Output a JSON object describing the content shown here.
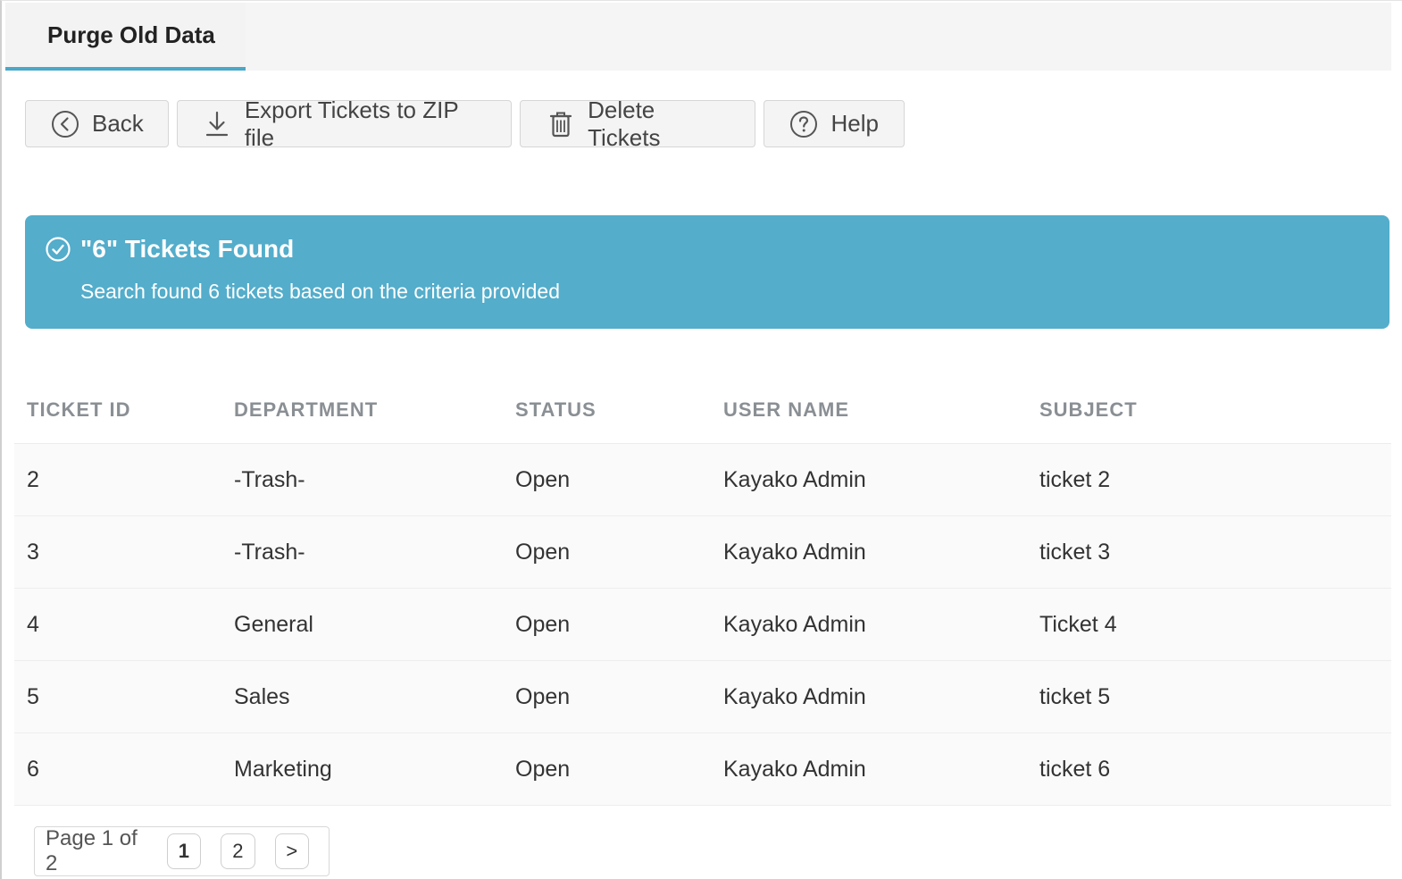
{
  "tabs": [
    {
      "label": "Purge Old Data"
    }
  ],
  "toolbar": {
    "back_label": "Back",
    "export_label": "Export Tickets to ZIP file",
    "delete_label": "Delete Tickets",
    "help_label": "Help"
  },
  "alert": {
    "title": "\"6\" Tickets Found",
    "message": "Search found 6 tickets based on the criteria provided",
    "color": "#53adcb"
  },
  "table": {
    "columns": [
      "TICKET ID",
      "DEPARTMENT",
      "STATUS",
      "USER NAME",
      "SUBJECT"
    ],
    "rows": [
      [
        "2",
        "-Trash-",
        "Open",
        "Kayako Admin",
        "ticket 2"
      ],
      [
        "3",
        "-Trash-",
        "Open",
        "Kayako Admin",
        "ticket 3"
      ],
      [
        "4",
        "General",
        "Open",
        "Kayako Admin",
        "Ticket 4"
      ],
      [
        "5",
        "Sales",
        "Open",
        "Kayako Admin",
        "ticket 5"
      ],
      [
        "6",
        "Marketing",
        "Open",
        "Kayako Admin",
        "ticket 6"
      ]
    ]
  },
  "pagination": {
    "label": "Page 1 of 2",
    "pages": [
      "1",
      "2"
    ],
    "current": "1",
    "next_label": ">"
  },
  "icons": {
    "back": "chevron-left-circle-icon",
    "export": "download-icon",
    "delete": "trash-icon",
    "help": "question-circle-icon",
    "alert": "check-circle-icon"
  },
  "colors": {
    "accent": "#4aa8c8",
    "alert_bg": "#53adcb"
  }
}
